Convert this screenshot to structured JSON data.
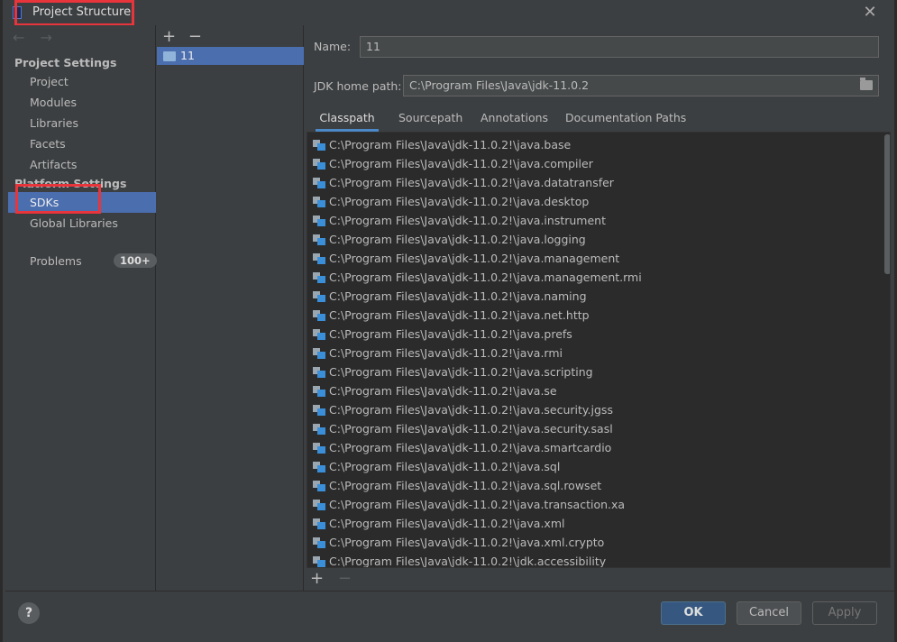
{
  "window": {
    "title": "Project Structure",
    "close_glyph": "✕"
  },
  "nav": {
    "back_forward": "← →",
    "project_settings_title": "Project Settings",
    "project_items": [
      "Project",
      "Modules",
      "Libraries",
      "Facets",
      "Artifacts"
    ],
    "platform_settings_title": "Platform Settings",
    "platform_items": [
      "SDKs",
      "Global Libraries"
    ],
    "selected": "SDKs",
    "problems_label": "Problems",
    "problems_badge": "100+"
  },
  "sdk_list": {
    "add_glyph": "+",
    "remove_glyph": "−",
    "items": [
      "11"
    ]
  },
  "sdk_details": {
    "name_label": "Name:",
    "name_value": "11",
    "jdk_path_label": "JDK home path:",
    "jdk_path_value": "C:\\Program Files\\Java\\jdk-11.0.2",
    "tabs": [
      "Classpath",
      "Sourcepath",
      "Annotations",
      "Documentation Paths"
    ],
    "active_tab": "Classpath",
    "classpath": [
      "C:\\Program Files\\Java\\jdk-11.0.2!\\java.base",
      "C:\\Program Files\\Java\\jdk-11.0.2!\\java.compiler",
      "C:\\Program Files\\Java\\jdk-11.0.2!\\java.datatransfer",
      "C:\\Program Files\\Java\\jdk-11.0.2!\\java.desktop",
      "C:\\Program Files\\Java\\jdk-11.0.2!\\java.instrument",
      "C:\\Program Files\\Java\\jdk-11.0.2!\\java.logging",
      "C:\\Program Files\\Java\\jdk-11.0.2!\\java.management",
      "C:\\Program Files\\Java\\jdk-11.0.2!\\java.management.rmi",
      "C:\\Program Files\\Java\\jdk-11.0.2!\\java.naming",
      "C:\\Program Files\\Java\\jdk-11.0.2!\\java.net.http",
      "C:\\Program Files\\Java\\jdk-11.0.2!\\java.prefs",
      "C:\\Program Files\\Java\\jdk-11.0.2!\\java.rmi",
      "C:\\Program Files\\Java\\jdk-11.0.2!\\java.scripting",
      "C:\\Program Files\\Java\\jdk-11.0.2!\\java.se",
      "C:\\Program Files\\Java\\jdk-11.0.2!\\java.security.jgss",
      "C:\\Program Files\\Java\\jdk-11.0.2!\\java.security.sasl",
      "C:\\Program Files\\Java\\jdk-11.0.2!\\java.smartcardio",
      "C:\\Program Files\\Java\\jdk-11.0.2!\\java.sql",
      "C:\\Program Files\\Java\\jdk-11.0.2!\\java.sql.rowset",
      "C:\\Program Files\\Java\\jdk-11.0.2!\\java.transaction.xa",
      "C:\\Program Files\\Java\\jdk-11.0.2!\\java.xml",
      "C:\\Program Files\\Java\\jdk-11.0.2!\\java.xml.crypto",
      "C:\\Program Files\\Java\\jdk-11.0.2!\\jdk.accessibility"
    ],
    "list_add_glyph": "+",
    "list_remove_glyph": "−"
  },
  "buttons": {
    "help": "?",
    "ok": "OK",
    "cancel": "Cancel",
    "apply": "Apply"
  },
  "colors": {
    "selection": "#4b6eaf",
    "highlight_box": "#e8343b",
    "accent_tab": "#4a88c7"
  }
}
